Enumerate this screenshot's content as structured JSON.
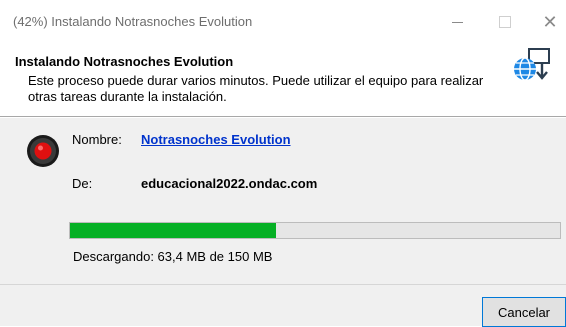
{
  "window": {
    "title": "(42%) Instalando Notrasnoches  Evolution",
    "minimize_symbol": "—",
    "maximize_symbol": "☐",
    "close_symbol": "✕"
  },
  "header": {
    "title": "Instalando Notrasnoches  Evolution",
    "description": "Este proceso puede durar varios minutos. Puede utilizar el equipo para realizar otras tareas durante la instalación.",
    "icon": "globe-download-icon"
  },
  "details": {
    "icon": "record-icon",
    "name_label": "Nombre:",
    "name_value": "Notrasnoches  Evolution",
    "from_label": "De:",
    "from_value": "educacional2022.ondac.com"
  },
  "progress": {
    "percent": 42,
    "fill_color": "#06b025",
    "status": "Descargando: 63,4 MB de 150 MB"
  },
  "footer": {
    "cancel_label": "Cancelar"
  }
}
